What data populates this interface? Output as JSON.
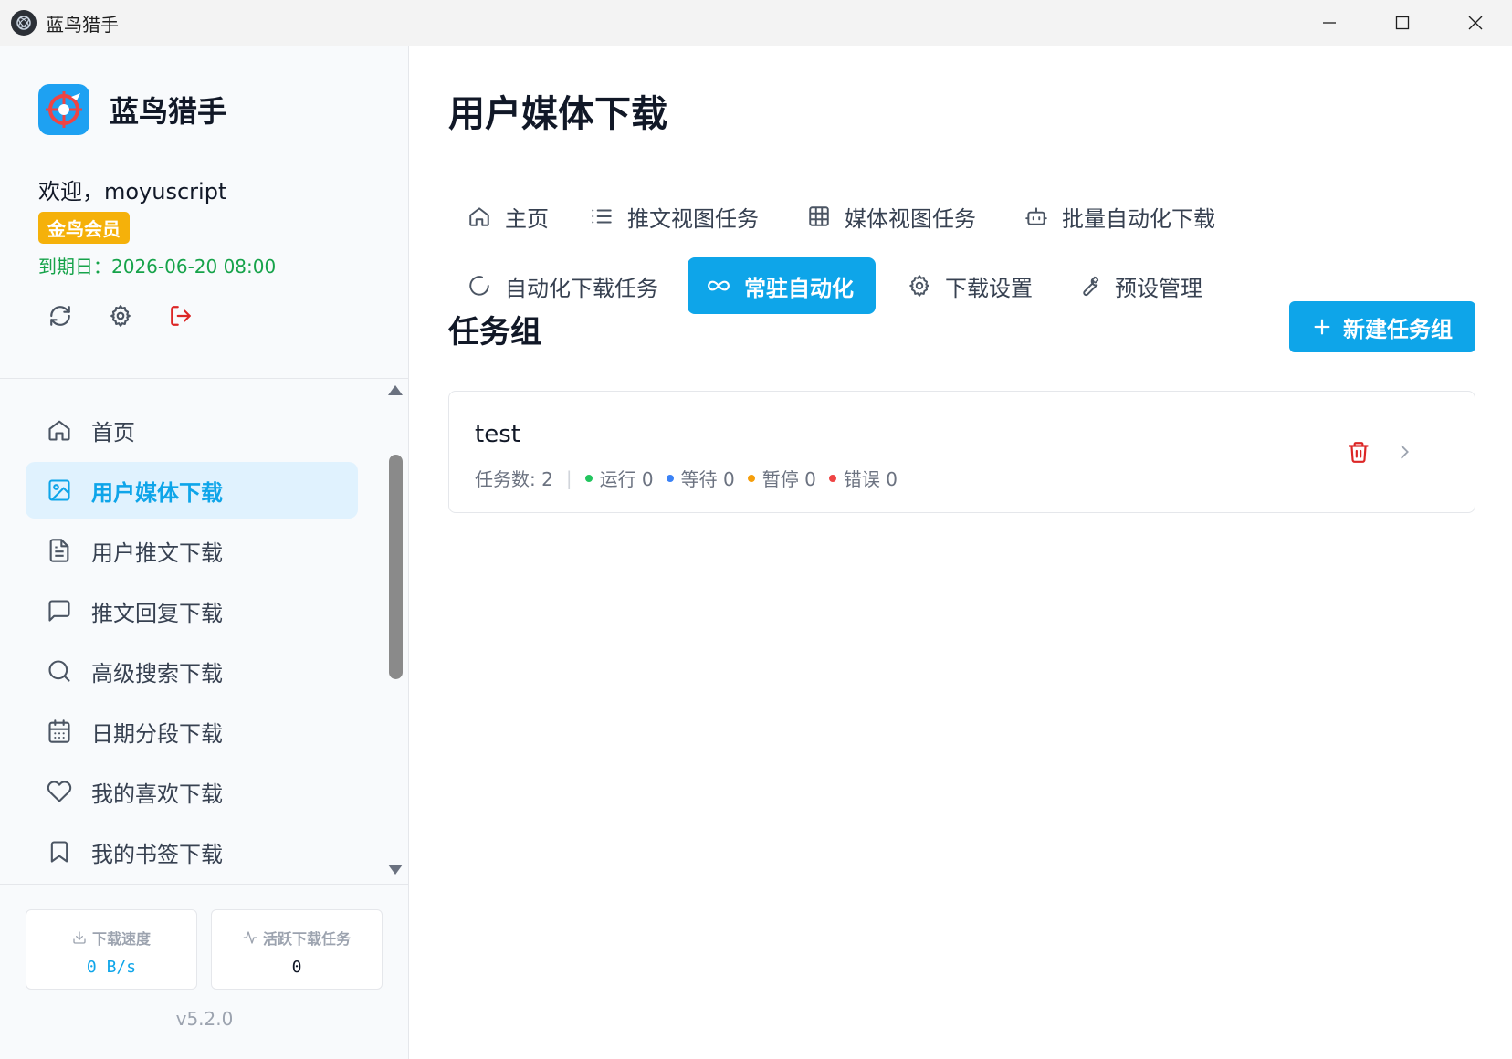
{
  "window": {
    "title": "蓝鸟猎手"
  },
  "sidebar": {
    "brand": "蓝鸟猎手",
    "welcome": "欢迎，moyuscript",
    "membership": "金鸟会员",
    "expiry": "到期日：2026-06-20 08:00",
    "nav": [
      {
        "label": "首页",
        "icon": "home-icon"
      },
      {
        "label": "用户媒体下载",
        "icon": "image-icon",
        "active": true
      },
      {
        "label": "用户推文下载",
        "icon": "document-icon"
      },
      {
        "label": "推文回复下载",
        "icon": "comment-icon"
      },
      {
        "label": "高级搜索下载",
        "icon": "search-icon"
      },
      {
        "label": "日期分段下载",
        "icon": "calendar-icon"
      },
      {
        "label": "我的喜欢下载",
        "icon": "heart-icon"
      },
      {
        "label": "我的书签下载",
        "icon": "bookmark-icon"
      }
    ],
    "stats": {
      "speed_label": "下载速度",
      "speed_value": "0 B/s",
      "active_label": "活跃下载任务",
      "active_value": "0"
    },
    "version": "v5.2.0"
  },
  "main": {
    "title": "用户媒体下载",
    "tabs": [
      {
        "label": "主页",
        "icon": "home-icon"
      },
      {
        "label": "推文视图任务",
        "icon": "list-icon"
      },
      {
        "label": "媒体视图任务",
        "icon": "grid-icon"
      },
      {
        "label": "批量自动化下载",
        "icon": "robot-icon"
      },
      {
        "label": "自动化下载任务",
        "icon": "loading-icon"
      },
      {
        "label": "常驻自动化",
        "icon": "infinity-icon",
        "active": true
      },
      {
        "label": "下载设置",
        "icon": "gear-icon"
      },
      {
        "label": "预设管理",
        "icon": "wrench-icon"
      }
    ],
    "section_title": "任务组",
    "new_group_label": "新建任务组",
    "groups": [
      {
        "name": "test",
        "task_count": "任务数: 2",
        "running": "运行 0",
        "waiting": "等待 0",
        "paused": "暂停 0",
        "error": "错误 0"
      }
    ]
  },
  "colors": {
    "accent": "#0ea5e9",
    "gold": "#f5b10a",
    "green": "#16a34a",
    "danger": "#dc2626",
    "running": "#22c55e",
    "waiting": "#3b82f6",
    "paused": "#f59e0b",
    "error": "#ef4444"
  }
}
